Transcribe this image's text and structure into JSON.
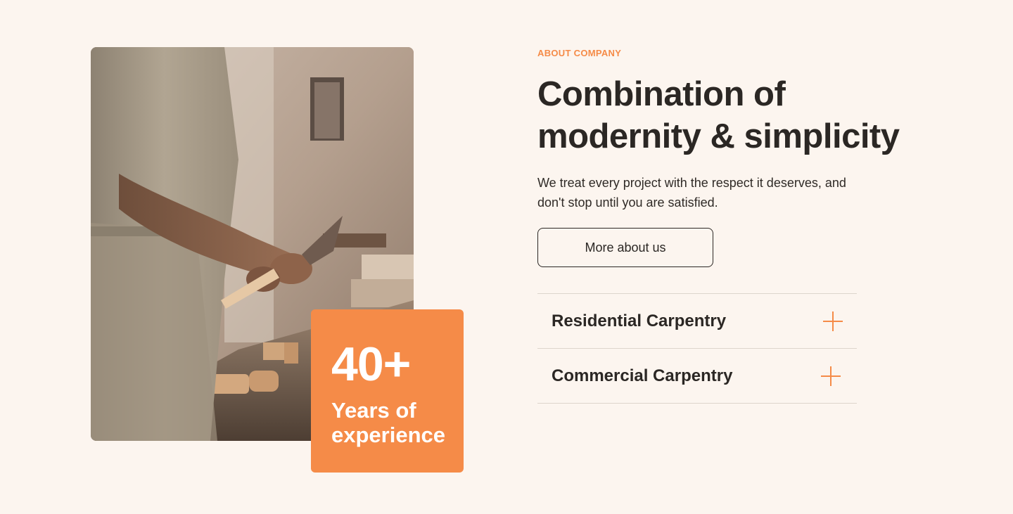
{
  "badge": {
    "number": "40+",
    "label": "Years of experience"
  },
  "about": {
    "eyebrow": "ABOUT COMPANY",
    "heading": "Combination of modernity & simplicity",
    "description": "We treat every project with the respect it deserves, and don't stop until you are satisfied.",
    "button_label": "More about us"
  },
  "accordion": {
    "items": [
      {
        "title": "Residential Carpentry",
        "icon": "plus-icon"
      },
      {
        "title": "Commercial Carpentry",
        "icon": "plus-icon"
      }
    ]
  },
  "colors": {
    "background": "#fcf5ef",
    "accent": "#f58b48",
    "text": "#2b2724"
  }
}
